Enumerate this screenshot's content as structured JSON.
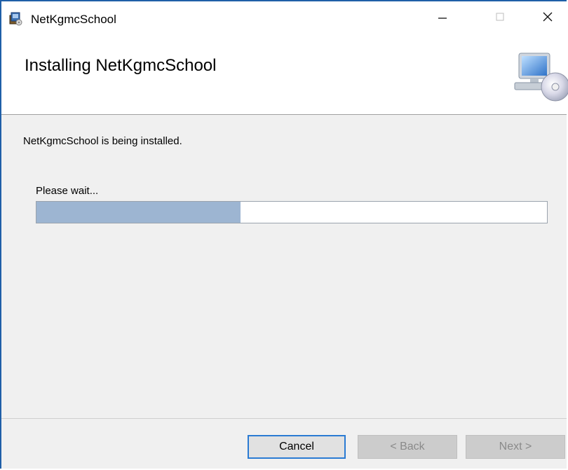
{
  "window": {
    "title": "NetKgmcSchool",
    "controls": {
      "minimize_icon": "minimize-icon",
      "maximize_icon": "maximize-icon",
      "close_icon": "close-icon"
    }
  },
  "header": {
    "title": "Installing NetKgmcSchool",
    "icon": "computer-cd-icon"
  },
  "main": {
    "status": "NetKgmcSchool is being installed.",
    "wait_label": "Please wait...",
    "progress_fraction": 0.4
  },
  "footer": {
    "cancel_label": "Cancel",
    "back_label": "< Back",
    "next_label": "Next >"
  },
  "colors": {
    "accent": "#1f5fa8",
    "progress_fill": "#9db5d2",
    "focus_border": "#2a7bd3"
  }
}
